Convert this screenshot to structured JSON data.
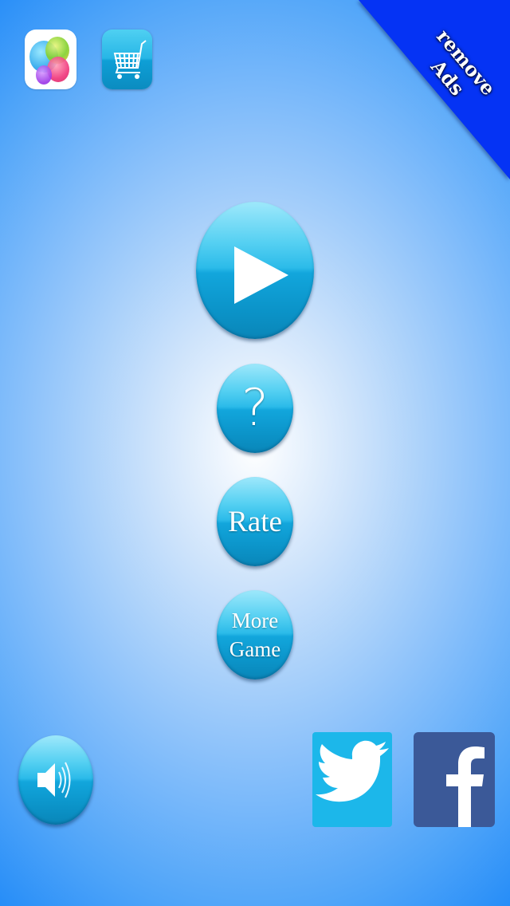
{
  "top_bar": {
    "game_center": {
      "icon": "game-center-icon"
    },
    "store": {
      "icon": "shopping-cart-icon"
    }
  },
  "ribbon": {
    "line1": "remove",
    "line2": "Ads",
    "color": "#0533f4"
  },
  "menu": {
    "play": {
      "icon": "play-icon"
    },
    "help": {
      "label": "?"
    },
    "rate": {
      "label": "Rate"
    },
    "more": {
      "line1": "More",
      "line2": "Game"
    }
  },
  "bottom": {
    "sound": {
      "icon": "speaker-icon",
      "state": "on"
    },
    "twitter": {
      "icon": "twitter-bird-icon",
      "color": "#1cb7ea"
    },
    "facebook": {
      "icon": "facebook-f-icon",
      "color": "#3b5998"
    }
  },
  "colors": {
    "button_blue": "#12a6dc",
    "background_edge": "#1a86f8",
    "background_center": "#ffffff"
  }
}
